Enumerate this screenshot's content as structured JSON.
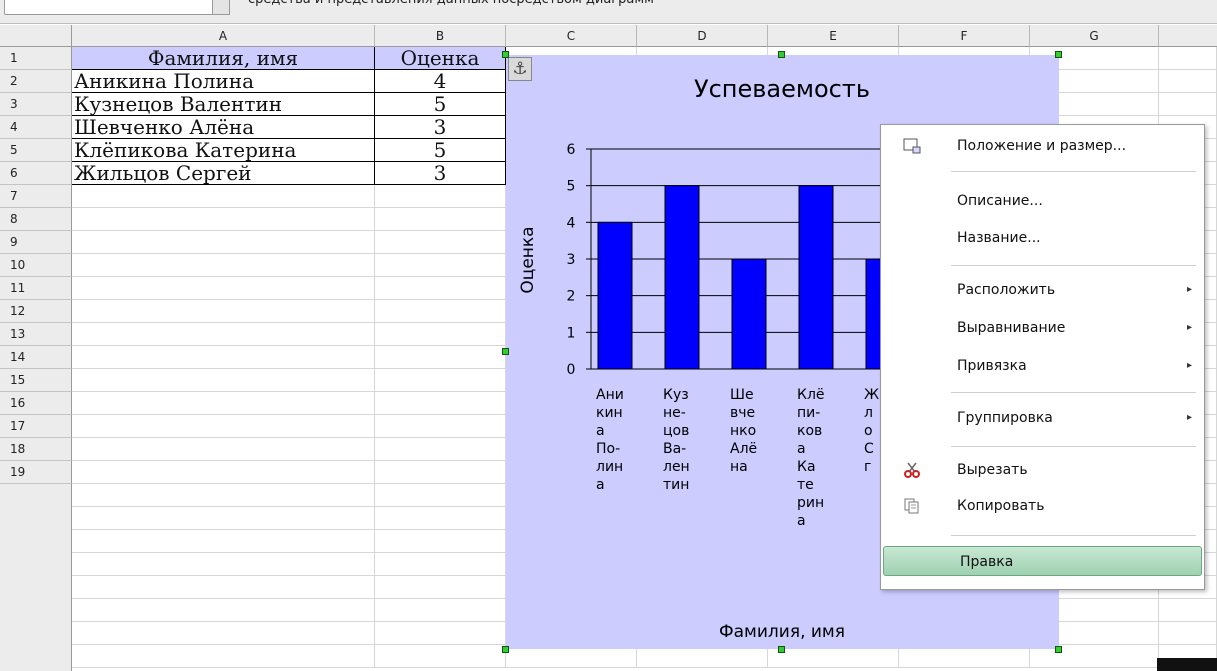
{
  "formula_bar": {
    "text": "средства и представления данных посредством диаграмм"
  },
  "sheet": {
    "columns": [
      "A",
      "B",
      "C",
      "D",
      "E",
      "F",
      "G"
    ],
    "rows": [
      "1",
      "2",
      "3",
      "4",
      "5",
      "6",
      "7",
      "8",
      "9",
      "10",
      "11",
      "12",
      "13",
      "14",
      "15",
      "16",
      "17",
      "18",
      "19"
    ],
    "header_name": "Фамилия, имя",
    "header_grade": "Оценка",
    "records": [
      {
        "name": "Аникина Полина",
        "grade": "4"
      },
      {
        "name": "Кузнецов Валентин",
        "grade": "5"
      },
      {
        "name": "Шевченко Алёна",
        "grade": "3"
      },
      {
        "name": "Клёпикова Катерина",
        "grade": "5"
      },
      {
        "name": "Жильцов Сергей",
        "grade": "3"
      }
    ]
  },
  "chart_data": {
    "type": "bar",
    "title": "Успеваемость",
    "xlabel": "Фамилия, имя",
    "ylabel": "Оценка",
    "ylim": [
      0,
      6
    ],
    "yticks": [
      0,
      1,
      2,
      3,
      4,
      5,
      6
    ],
    "grid": true,
    "bar_color": "#0000ff",
    "background": "#ccccff",
    "categories": [
      "Аникина Полина",
      "Кузнецов Валентин",
      "Шевченко Алёна",
      "Клёпикова Катерина",
      "Жильцов Сергей"
    ],
    "category_label_lines": [
      [
        "Ани",
        "кин",
        "а",
        "По-",
        "лин",
        "а"
      ],
      [
        "Куз",
        "не-",
        "цов",
        "Ва-",
        "лен",
        "тин"
      ],
      [
        "Ше",
        "вче",
        "нко",
        "Алё",
        "на"
      ],
      [
        "Клё",
        "пи-",
        "ков",
        "а",
        "Ка",
        "те",
        "рин",
        "а"
      ],
      [
        "Ж",
        "л",
        "о",
        "С",
        "г"
      ]
    ],
    "values": [
      4,
      5,
      3,
      5,
      3
    ]
  },
  "context_menu": {
    "items": [
      {
        "label": "Положение и размер...",
        "icon": "position-size-icon",
        "submenu": false
      },
      {
        "label": "Описание...",
        "submenu": false
      },
      {
        "label": "Название...",
        "submenu": false
      },
      {
        "label": "Расположить",
        "submenu": true
      },
      {
        "label": "Выравнивание",
        "submenu": true
      },
      {
        "label": "Привязка",
        "submenu": true
      },
      {
        "label": "Группировка",
        "submenu": true
      },
      {
        "label": "Вырезать",
        "icon": "scissors-icon",
        "submenu": false
      },
      {
        "label": "Копировать",
        "icon": "copy-icon",
        "submenu": false
      },
      {
        "label": "Правка",
        "submenu": false,
        "highlighted": true
      }
    ],
    "submenu_arrow": "▸",
    "highlight_color": "#a8d8b9"
  },
  "anchor_icon": "⚓"
}
